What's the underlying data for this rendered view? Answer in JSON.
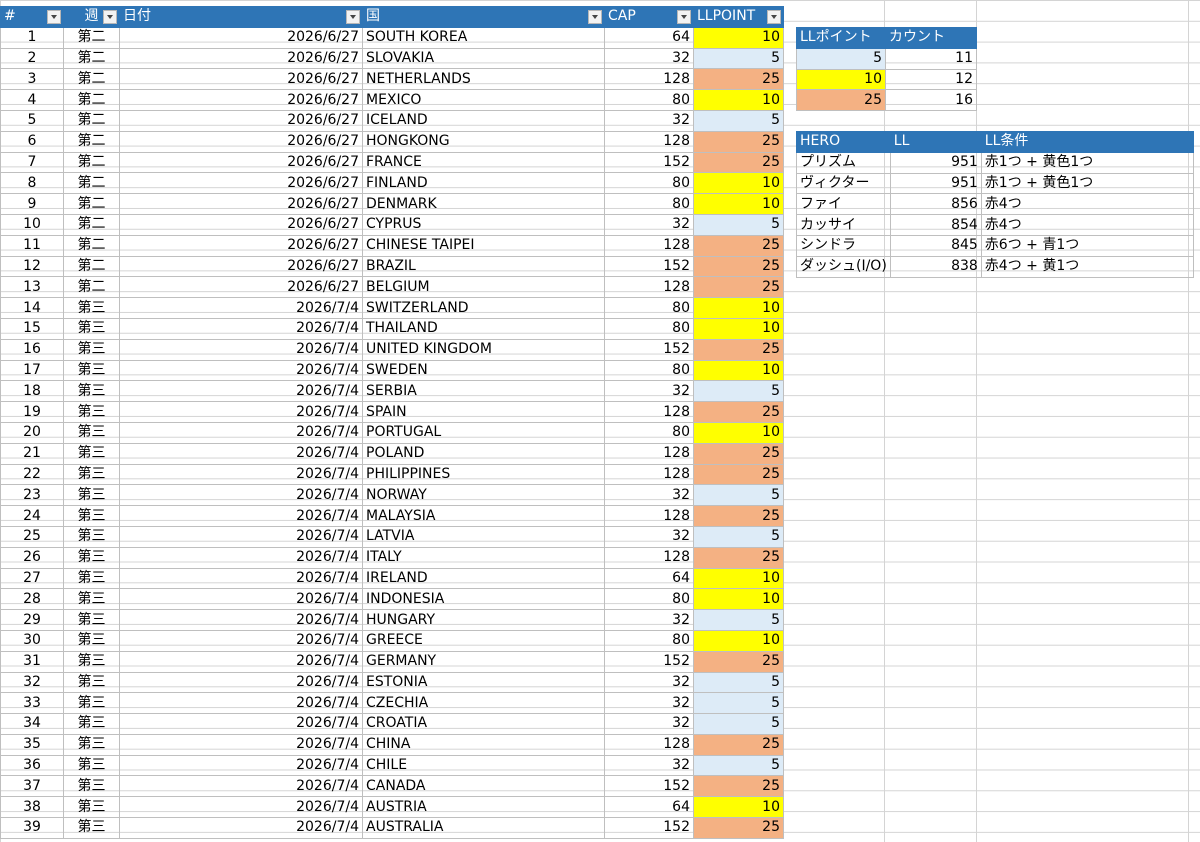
{
  "main_table": {
    "headers": [
      "#",
      "週",
      "日付",
      "国",
      "CAP",
      "LLPOINT"
    ],
    "rows": [
      [
        "1",
        "第二",
        "2026/6/27",
        "SOUTH KOREA",
        "64",
        "10"
      ],
      [
        "2",
        "第二",
        "2026/6/27",
        "SLOVAKIA",
        "32",
        "5"
      ],
      [
        "3",
        "第二",
        "2026/6/27",
        "NETHERLANDS",
        "128",
        "25"
      ],
      [
        "4",
        "第二",
        "2026/6/27",
        "MEXICO",
        "80",
        "10"
      ],
      [
        "5",
        "第二",
        "2026/6/27",
        "ICELAND",
        "32",
        "5"
      ],
      [
        "6",
        "第二",
        "2026/6/27",
        "HONGKONG",
        "128",
        "25"
      ],
      [
        "7",
        "第二",
        "2026/6/27",
        "FRANCE",
        "152",
        "25"
      ],
      [
        "8",
        "第二",
        "2026/6/27",
        "FINLAND",
        "80",
        "10"
      ],
      [
        "9",
        "第二",
        "2026/6/27",
        "DENMARK",
        "80",
        "10"
      ],
      [
        "10",
        "第二",
        "2026/6/27",
        "CYPRUS",
        "32",
        "5"
      ],
      [
        "11",
        "第二",
        "2026/6/27",
        "CHINESE TAIPEI",
        "128",
        "25"
      ],
      [
        "12",
        "第二",
        "2026/6/27",
        "BRAZIL",
        "152",
        "25"
      ],
      [
        "13",
        "第二",
        "2026/6/27",
        "BELGIUM",
        "128",
        "25"
      ],
      [
        "14",
        "第三",
        "2026/7/4",
        "SWITZERLAND",
        "80",
        "10"
      ],
      [
        "15",
        "第三",
        "2026/7/4",
        "THAILAND",
        "80",
        "10"
      ],
      [
        "16",
        "第三",
        "2026/7/4",
        "UNITED KINGDOM",
        "152",
        "25"
      ],
      [
        "17",
        "第三",
        "2026/7/4",
        "SWEDEN",
        "80",
        "10"
      ],
      [
        "18",
        "第三",
        "2026/7/4",
        "SERBIA",
        "32",
        "5"
      ],
      [
        "19",
        "第三",
        "2026/7/4",
        "SPAIN",
        "128",
        "25"
      ],
      [
        "20",
        "第三",
        "2026/7/4",
        "PORTUGAL",
        "80",
        "10"
      ],
      [
        "21",
        "第三",
        "2026/7/4",
        "POLAND",
        "128",
        "25"
      ],
      [
        "22",
        "第三",
        "2026/7/4",
        "PHILIPPINES",
        "128",
        "25"
      ],
      [
        "23",
        "第三",
        "2026/7/4",
        "NORWAY",
        "32",
        "5"
      ],
      [
        "24",
        "第三",
        "2026/7/4",
        "MALAYSIA",
        "128",
        "25"
      ],
      [
        "25",
        "第三",
        "2026/7/4",
        "LATVIA",
        "32",
        "5"
      ],
      [
        "26",
        "第三",
        "2026/7/4",
        "ITALY",
        "128",
        "25"
      ],
      [
        "27",
        "第三",
        "2026/7/4",
        "IRELAND",
        "64",
        "10"
      ],
      [
        "28",
        "第三",
        "2026/7/4",
        "INDONESIA",
        "80",
        "10"
      ],
      [
        "29",
        "第三",
        "2026/7/4",
        "HUNGARY",
        "32",
        "5"
      ],
      [
        "30",
        "第三",
        "2026/7/4",
        "GREECE",
        "80",
        "10"
      ],
      [
        "31",
        "第三",
        "2026/7/4",
        "GERMANY",
        "152",
        "25"
      ],
      [
        "32",
        "第三",
        "2026/7/4",
        "ESTONIA",
        "32",
        "5"
      ],
      [
        "33",
        "第三",
        "2026/7/4",
        "CZECHIA",
        "32",
        "5"
      ],
      [
        "34",
        "第三",
        "2026/7/4",
        "CROATIA",
        "32",
        "5"
      ],
      [
        "35",
        "第三",
        "2026/7/4",
        "CHINA",
        "128",
        "25"
      ],
      [
        "36",
        "第三",
        "2026/7/4",
        "CHILE",
        "32",
        "5"
      ],
      [
        "37",
        "第三",
        "2026/7/4",
        "CANADA",
        "152",
        "25"
      ],
      [
        "38",
        "第三",
        "2026/7/4",
        "AUSTRIA",
        "64",
        "10"
      ],
      [
        "39",
        "第三",
        "2026/7/4",
        "AUSTRALIA",
        "152",
        "25"
      ]
    ]
  },
  "count_table": {
    "headers": [
      "LLポイント",
      "カウント"
    ],
    "rows": [
      [
        "5",
        "11"
      ],
      [
        "10",
        "12"
      ],
      [
        "25",
        "16"
      ]
    ]
  },
  "hero_table": {
    "headers": [
      "HERO",
      "LL",
      "LL条件"
    ],
    "rows": [
      [
        "プリズム",
        "951",
        "赤1つ + 黄色1つ"
      ],
      [
        "ヴィクター",
        "951",
        "赤1つ + 黄色1つ"
      ],
      [
        "ファイ",
        "856",
        "赤4つ"
      ],
      [
        "カッサイ",
        "854",
        "赤4つ"
      ],
      [
        "シンドラ",
        "845",
        "赤6つ + 青1つ"
      ],
      [
        "ダッシュ(I/O)",
        "838",
        "赤4つ + 黄1つ"
      ]
    ]
  },
  "colors": {
    "header_blue": "#2e75b6",
    "point_5": "#ddebf7",
    "point_10": "#ffff00",
    "point_25": "#f4b183"
  }
}
